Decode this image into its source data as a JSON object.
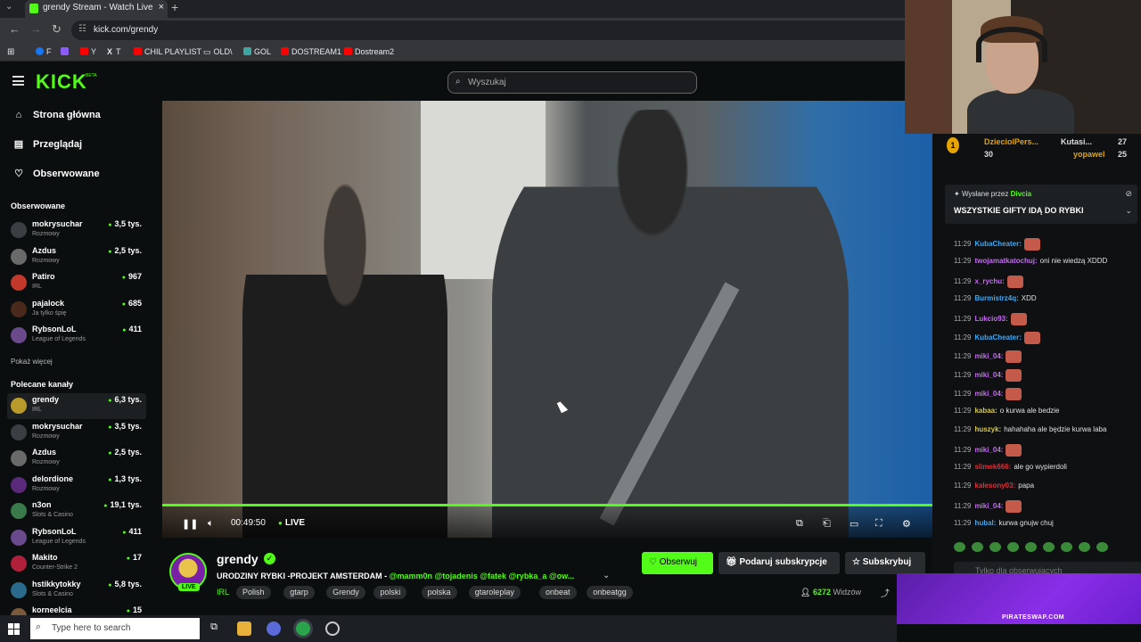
{
  "browser": {
    "tab_title": "grendy Stream - Watch Live",
    "url": "kick.com/grendy",
    "bookmarks": [
      {
        "label": "F",
        "color": "#1877f2"
      },
      {
        "label": "",
        "color": "#8b5cf6"
      },
      {
        "label": "Y",
        "color": "#ff0000"
      },
      {
        "label": "T",
        "color": "#ffffff"
      },
      {
        "label": "CHIL PLAYLIST",
        "color": "#ff0000"
      },
      {
        "label": "OLD\\",
        "color": "#999999"
      },
      {
        "label": "GOL",
        "color": "#3ba7a0"
      },
      {
        "label": "DOSTREAM1",
        "color": "#ff0000"
      },
      {
        "label": "Dostream2",
        "color": "#ff0000"
      }
    ]
  },
  "header": {
    "logo": "KICK",
    "logo_badge": "BETA",
    "search_placeholder": "Wyszukaj"
  },
  "sidebar": {
    "nav": [
      {
        "label": "Strona główna",
        "icon": "home-icon"
      },
      {
        "label": "Przeglądaj",
        "icon": "browse-icon"
      },
      {
        "label": "Obserwowane",
        "icon": "heart-icon"
      }
    ],
    "followed_heading": "Obserwowane",
    "followed": [
      {
        "name": "mokrysuchar",
        "category": "Rozmowy",
        "viewers": "3,5 tys.",
        "color": "#3a3f44"
      },
      {
        "name": "Azdus",
        "category": "Rozmowy",
        "viewers": "2,5 tys.",
        "color": "#6a6a6a"
      },
      {
        "name": "Patiro",
        "category": "IRL",
        "viewers": "967",
        "color": "#c0392b"
      },
      {
        "name": "pajalock",
        "category": "Ja tylko śpię",
        "viewers": "685",
        "color": "#4a2a1a"
      },
      {
        "name": "RybsonLoL",
        "category": "League of Legends",
        "viewers": "411",
        "color": "#6a4a8a"
      }
    ],
    "show_more": "Pokaż więcej",
    "recommended_heading": "Polecane kanały",
    "recommended": [
      {
        "name": "grendy",
        "category": "IRL",
        "viewers": "6,3 tys.",
        "color": "#b89a2a"
      },
      {
        "name": "mokrysuchar",
        "category": "Rozmowy",
        "viewers": "3,5 tys.",
        "color": "#3a3f44"
      },
      {
        "name": "Azdus",
        "category": "Rozmowy",
        "viewers": "2,5 tys.",
        "color": "#6a6a6a"
      },
      {
        "name": "delordione",
        "category": "Rozmowy",
        "viewers": "1,3 tys.",
        "color": "#5a2a7a"
      },
      {
        "name": "n3on",
        "category": "Slots & Casino",
        "viewers": "19,1 tys.",
        "color": "#3a7a4a"
      },
      {
        "name": "RybsonLoL",
        "category": "League of Legends",
        "viewers": "411",
        "color": "#6a4a8a"
      },
      {
        "name": "Makito",
        "category": "Counter-Strike 2",
        "viewers": "17",
        "color": "#b0203a"
      },
      {
        "name": "hstikkytokky",
        "category": "Slots & Casino",
        "viewers": "5,8 tys.",
        "color": "#2a6a8a"
      },
      {
        "name": "korneelcia",
        "category": "",
        "viewers": "15",
        "color": "#7a5a3a"
      }
    ]
  },
  "player": {
    "time": "00:49:50",
    "live_label": "LIVE",
    "progress": 1.0
  },
  "stream": {
    "streamer": "grendy",
    "live_badge": "LIVE",
    "title_prefix": "URODZINY RYBKI -PROJEKT AMSTERDAM - ",
    "title_mentions": "@mamm0n @tojadenis @fatek @rybka_a @ow...",
    "category": "IRL",
    "tags": [
      "Polish",
      "gtarp",
      "Grendy",
      "polski",
      "polska",
      "gtaroleplay",
      "onbeat",
      "onbeatgg"
    ],
    "follow_label": "Obserwuj",
    "gift_label": "Podaruj subskrypcje",
    "subscribe_label": "Subskrybuj",
    "viewers": "6272",
    "viewers_label": "Widzów"
  },
  "chat": {
    "leaders": [
      {
        "name": "DzieciolPers...",
        "value": "30"
      },
      {
        "name": "Kutasi...",
        "value": "27"
      },
      {
        "name": "yopawel",
        "value": "25"
      }
    ],
    "pinned_by_prefix": "Wysłane przez",
    "pinned_by_user": "Divcia",
    "pinned_message": "WSZYSTKIE GIFTY IDĄ DO RYBKI",
    "messages": [
      {
        "time": "11:29",
        "user": "KubaCheater:",
        "text": "",
        "emote": true,
        "color": "#3fa9f5"
      },
      {
        "time": "11:29",
        "user": "twojamatkatochuj:",
        "text": "oni nie wiedzą XDDD",
        "emote": false,
        "color": "#c56cf0"
      },
      {
        "time": "11:29",
        "user": "x_rychu:",
        "text": "",
        "emote": true,
        "color": "#c56cf0"
      },
      {
        "time": "11:29",
        "user": "Burmistrz4q:",
        "text": "XDD",
        "emote": false,
        "color": "#3fa9f5"
      },
      {
        "time": "11:29",
        "user": "Lukcio93:",
        "text": "",
        "emote": true,
        "color": "#c56cf0"
      },
      {
        "time": "11:29",
        "user": "KubaCheater:",
        "text": "",
        "emote": true,
        "color": "#3fa9f5"
      },
      {
        "time": "11:29",
        "user": "miki_04:",
        "text": "",
        "emote": true,
        "color": "#c56cf0"
      },
      {
        "time": "11:29",
        "user": "miki_04:",
        "text": "",
        "emote": true,
        "color": "#c56cf0"
      },
      {
        "time": "11:29",
        "user": "miki_04:",
        "text": "",
        "emote": true,
        "color": "#c56cf0"
      },
      {
        "time": "11:29",
        "user": "kabaa:",
        "text": "o kurwa ale bedzie",
        "emote": false,
        "color": "#d7c84a"
      },
      {
        "time": "11:29",
        "user": "huszyk:",
        "text": "hahahaha ale będzie kurwa laba",
        "emote": false,
        "color": "#d7c84a"
      },
      {
        "time": "11:29",
        "user": "miki_04:",
        "text": "",
        "emote": true,
        "color": "#c56cf0"
      },
      {
        "time": "11:29",
        "user": "slimek666:",
        "text": "ale go wypierdoli",
        "emote": false,
        "color": "#e0303a"
      },
      {
        "time": "11:29",
        "user": "kalesony03:",
        "text": "papa",
        "emote": false,
        "color": "#e0303a"
      },
      {
        "time": "11:29",
        "user": "miki_04:",
        "text": "",
        "emote": true,
        "color": "#c56cf0"
      },
      {
        "time": "11:29",
        "user": "hubal:",
        "text": "kurwa gnujw chuj",
        "emote": false,
        "color": "#3fa9f5"
      }
    ],
    "input_placeholder": "Tylko dla obserwujących"
  },
  "promo": {
    "text": "PIRATESWAP.COM"
  },
  "taskbar": {
    "search_placeholder": "Type here to search"
  }
}
